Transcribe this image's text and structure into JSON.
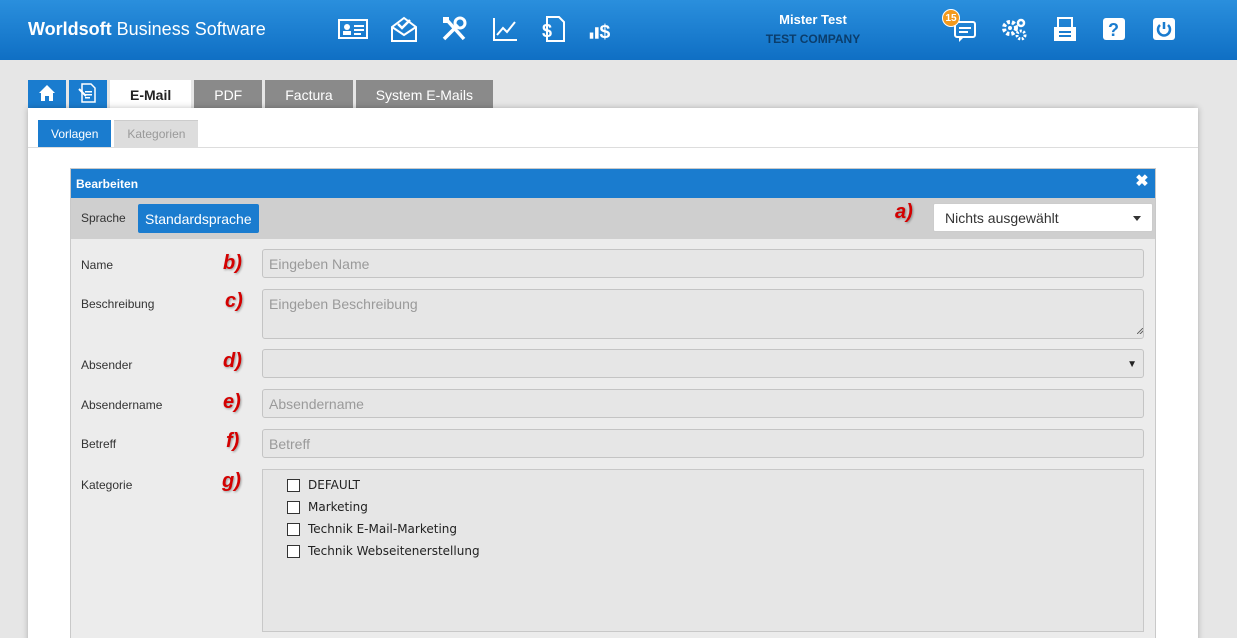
{
  "header": {
    "brand_bold": "Worldsoft",
    "brand_rest": " Business Software",
    "user_name": "Mister Test",
    "company": "TEST COMPANY",
    "badge_count": "15",
    "bg_color": "#1a7ccf",
    "icons": [
      "contact-card-icon",
      "mail-icon",
      "tools-icon",
      "chart-icon",
      "invoice-icon",
      "finance-chart-icon",
      "messages-icon",
      "settings-icon",
      "print-icon",
      "help-icon",
      "power-icon"
    ]
  },
  "tabs": [
    "E-Mail",
    "PDF",
    "Factura",
    "System E-Mails"
  ],
  "subtabs": [
    "Vorlagen",
    "Kategorien"
  ],
  "modal": {
    "title": "Bearbeiten",
    "close_glyph": "✖",
    "language_label": "Sprache",
    "language_button": "Standardsprache",
    "language_select": "Nichts ausgewählt"
  },
  "fields": {
    "name_label": "Name",
    "name_placeholder": "Eingeben Name",
    "description_label": "Beschreibung",
    "description_placeholder": "Eingeben Beschreibung",
    "sender_label": "Absender",
    "sender_value": "",
    "sender_name_label": "Absendername",
    "sender_name_placeholder": "Absendername",
    "subject_label": "Betreff",
    "subject_placeholder": "Betreff",
    "category_label": "Kategorie"
  },
  "categories": [
    "DEFAULT",
    "Marketing",
    "Technik E-Mail-Marketing",
    "Technik Webseitenerstellung"
  ],
  "annotations": [
    "a)",
    "b)",
    "c)",
    "d)",
    "e)",
    "f)",
    "g)"
  ]
}
